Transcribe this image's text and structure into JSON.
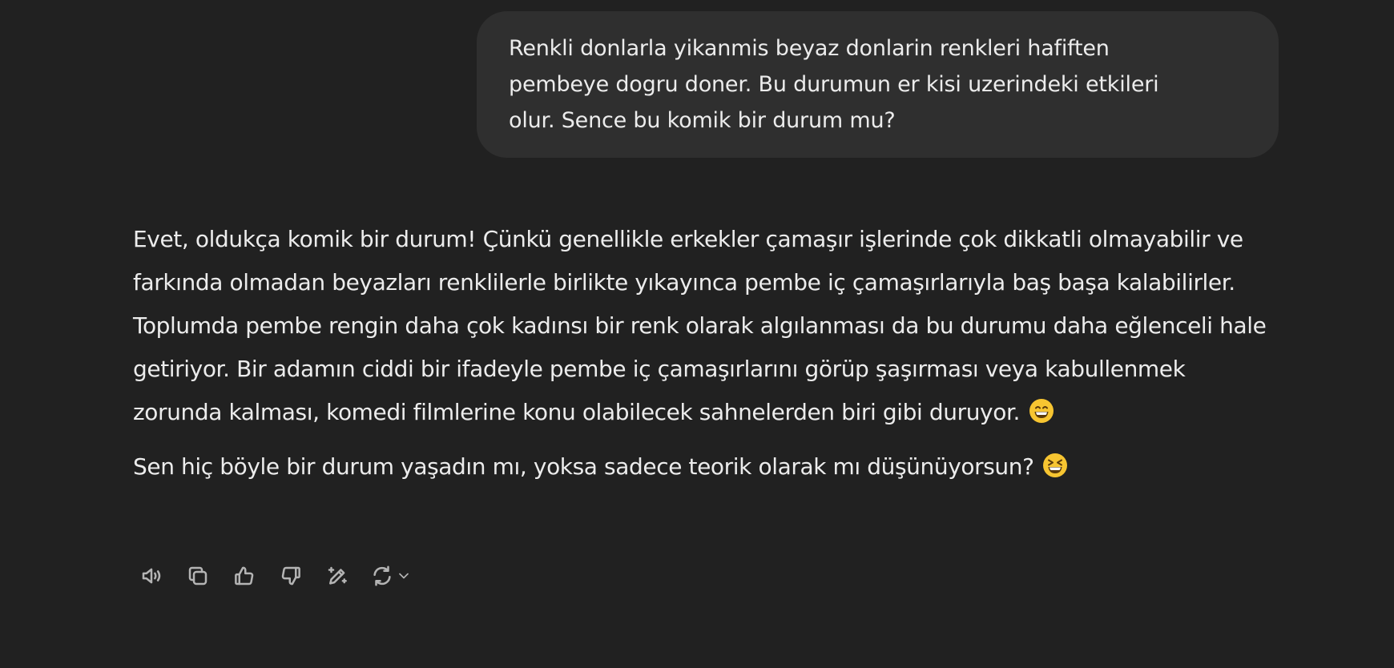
{
  "user_message": {
    "lines": [
      "Renkli donlarla yikanmis beyaz donlarin renkleri hafiften",
      "pembeye dogru doner. Bu durumun er kisi uzerindeki etkileri",
      "olur. Sence bu komik bir durum mu?"
    ]
  },
  "assistant_message": {
    "paragraph_1": "Evet, oldukça komik bir durum! Çünkü genellikle erkekler çamaşır işlerinde çok dikkatli olmayabilir ve farkında olmadan beyazları renklilerle birlikte yıkayınca pembe iç çamaşırlarıyla baş başa kalabilirler. Toplumda pembe rengin daha çok kadınsı bir renk olarak algılanması da bu durumu daha eğlenceli hale getiriyor. Bir adamın ciddi bir ifadeyle pembe iç çamaşırlarını görüp şaşırması veya kabullenmek zorunda kalması, komedi filmlerine konu olabilecek sahnelerden biri gibi duruyor.",
    "paragraph_2": "Sen hiç böyle bir durum yaşadın mı, yoksa sadece teorik olarak mı düşünüyorsun?",
    "emoji_1": "grinning-face-emoji",
    "emoji_2": "laughing-face-emoji"
  },
  "actions": [
    {
      "icon": "speaker-icon"
    },
    {
      "icon": "copy-icon"
    },
    {
      "icon": "thumbs-up-icon"
    },
    {
      "icon": "thumbs-down-icon"
    },
    {
      "icon": "edit-sparkle-icon"
    },
    {
      "icon": "regenerate-icon"
    }
  ],
  "colors": {
    "background": "#212121",
    "user_bubble": "#2f2f2f",
    "text": "#ececec",
    "icon": "#b4b4b4",
    "emoji": "#f7c531"
  }
}
